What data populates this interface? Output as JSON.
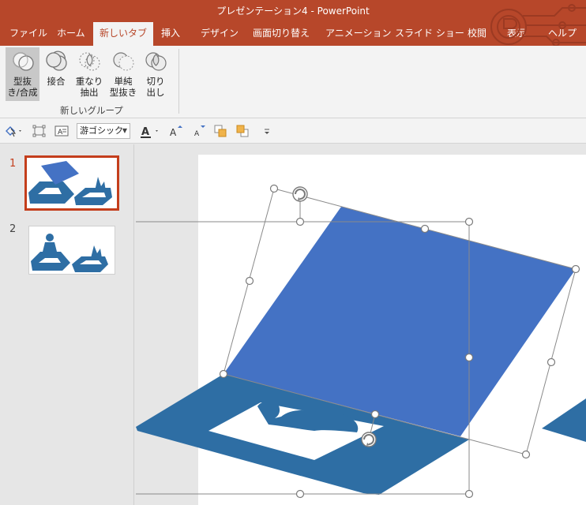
{
  "window": {
    "title": "プレゼンテーション4  -  PowerPoint"
  },
  "tabs": [
    {
      "label": "ファイル",
      "active": false
    },
    {
      "label": "ホーム",
      "active": false
    },
    {
      "label": "新しいタブ",
      "active": true
    },
    {
      "label": "挿入",
      "active": false
    },
    {
      "label": "デザイン",
      "active": false
    },
    {
      "label": "画面切り替え",
      "active": false
    },
    {
      "label": "アニメーション",
      "active": false
    },
    {
      "label": "スライド ショー",
      "active": false
    },
    {
      "label": "校閲",
      "active": false
    },
    {
      "label": "表示",
      "active": false
    },
    {
      "label": "ヘルプ",
      "active": false
    }
  ],
  "ribbon": {
    "group_label": "新しいグループ",
    "buttons": [
      {
        "label_line1": "型抜",
        "label_line2": "き/合成",
        "icon": "union-shapes-icon",
        "pressed": true
      },
      {
        "label_line1": "接合",
        "label_line2": "",
        "icon": "combine-shapes-icon",
        "pressed": false
      },
      {
        "label_line1": "重なり",
        "label_line2": "抽出",
        "icon": "intersect-shapes-icon",
        "pressed": false
      },
      {
        "label_line1": "単純",
        "label_line2": "型抜き",
        "icon": "subtract-shapes-icon",
        "pressed": false
      },
      {
        "label_line1": "切り",
        "label_line2": "出し",
        "icon": "fragment-shapes-icon",
        "pressed": false
      }
    ]
  },
  "mini_toolbar": {
    "font": "游ゴシック",
    "icons": [
      "shape-select-icon",
      "shape-outline-icon",
      "text-box-icon",
      "font-color-icon",
      "increase-font-icon",
      "decrease-font-icon",
      "bring-forward-icon",
      "send-backward-icon",
      "more-options-icon"
    ]
  },
  "slides": [
    {
      "number": "1",
      "active": true
    },
    {
      "number": "2",
      "active": false
    }
  ],
  "colors": {
    "accent": "#b7472a",
    "shape_blue": "#4472c4",
    "shadow_blue": "#2e6ea4",
    "selection_outline": "#c43e1c"
  }
}
